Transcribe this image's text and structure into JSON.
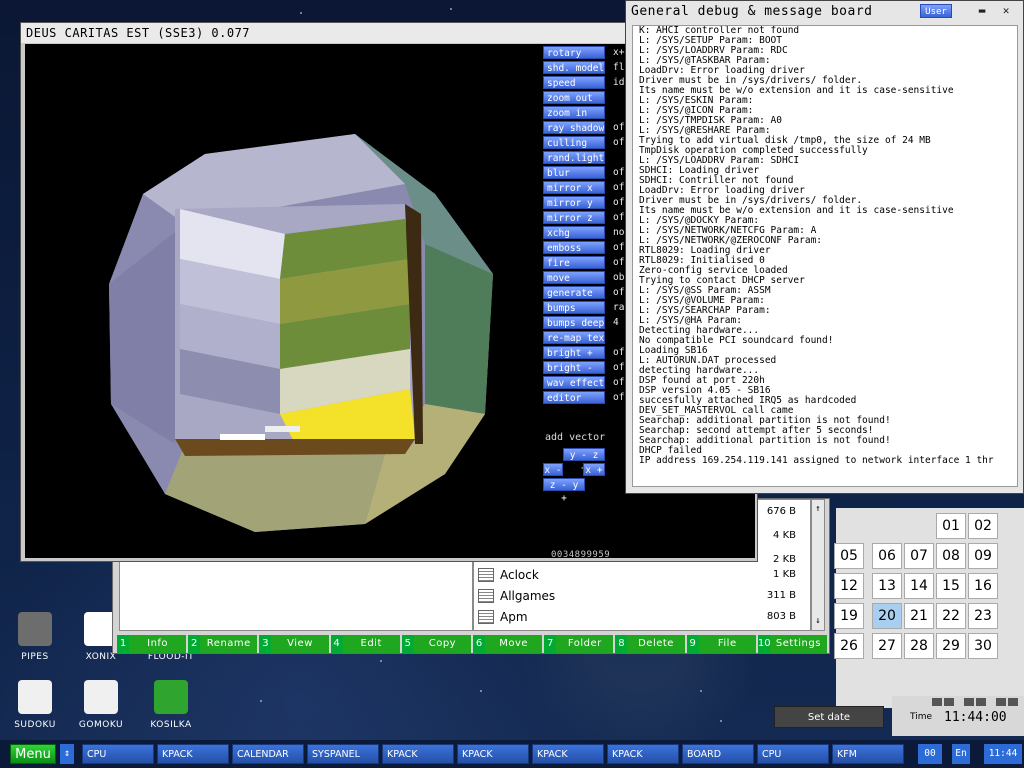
{
  "demo": {
    "title": "DEUS CARITAS EST (SSE3) 0.077",
    "menu": [
      {
        "label": "rotary",
        "value": "x+"
      },
      {
        "label": "shd. model",
        "value": "fl"
      },
      {
        "label": "speed",
        "value": "id"
      },
      {
        "label": "zoom out",
        "value": ""
      },
      {
        "label": "zoom in",
        "value": ""
      },
      {
        "label": "ray shadow",
        "value": "of"
      },
      {
        "label": "culling",
        "value": "of"
      },
      {
        "label": "rand.light",
        "value": ""
      },
      {
        "label": "blur",
        "value": "of"
      },
      {
        "label": "mirror x",
        "value": "of"
      },
      {
        "label": "mirror y",
        "value": "of"
      },
      {
        "label": "mirror z",
        "value": "of"
      },
      {
        "label": "xchg",
        "value": "no"
      },
      {
        "label": "emboss",
        "value": "of"
      },
      {
        "label": "fire",
        "value": "of"
      },
      {
        "label": "move",
        "value": "ob"
      },
      {
        "label": "generate",
        "value": "of"
      },
      {
        "label": "bumps",
        "value": "ra"
      },
      {
        "label": "bumps deep",
        "value": "4"
      },
      {
        "label": "re-map tex",
        "value": ""
      },
      {
        "label": "bright +",
        "value": "of"
      },
      {
        "label": "bright -",
        "value": "of"
      },
      {
        "label": "wav effect",
        "value": "of"
      },
      {
        "label": "editor",
        "value": "of"
      }
    ],
    "add_vector_label": "add vector",
    "vector_buttons": {
      "yz": "y - z +",
      "xm": "x -",
      "xp": "x +",
      "zy": "z - y +"
    },
    "counter": "0034899959"
  },
  "debug": {
    "title": "General debug & message board",
    "user_button": "User",
    "close_glyph": "✕",
    "min_glyph": "▬",
    "lines": [
      "K: AHCI controller not found",
      "L: /SYS/SETUP Param: BOOT",
      "L: /SYS/LOADDRV Param: RDC",
      "L: /SYS/@TASKBAR Param:",
      "LoadDrv: Error loading driver",
      "Driver must be in /sys/drivers/ folder.",
      "Its name must be w/o extension and it is case-sensitive",
      "L: /SYS/ESKIN Param:",
      "L: /SYS/@ICON Param:",
      "L: /SYS/TMPDISK Param: A0",
      "L: /SYS/@RESHARE Param:",
      "Trying to add virtual disk /tmp0, the size of 24 MB",
      "TmpDisk operation completed successfully",
      "L: /SYS/LOADDRV Param: SDHCI",
      "SDHCI: Loading driver",
      "SDHCI: Contriller not found",
      "LoadDrv: Error loading driver",
      "Driver must be in /sys/drivers/ folder.",
      "Its name must be w/o extension and it is case-sensitive",
      "L: /SYS/@DOCKY Param:",
      "L: /SYS/NETWORK/NETCFG Param: A",
      "L: /SYS/NETWORK/@ZEROCONF Param:",
      "RTL8029: Loading driver",
      "RTL8029: Initialised 0",
      "Zero-config service loaded",
      "Trying to contact DHCP server",
      "L: /SYS/@SS Param: ASSM",
      "L: /SYS/@VOLUME Param:",
      "L: /SYS/SEARCHAP Param:",
      "L: /SYS/@HA Param:",
      "Detecting hardware...",
      "No compatible PCI soundcard found!",
      "Loading SB16",
      "L: AUTORUN.DAT processed",
      "detecting hardware...",
      "DSP found at port 220h",
      "DSP version 4.05 - SB16",
      "succesfully attached IRQ5 as hardcoded",
      "DEV_SET_MASTERVOL call came",
      "Searchap: additional partition is not found!",
      "Searchap: second attempt after 5 seconds!",
      "Searchap: additional partition is not found!",
      "DHCP failed",
      "IP address 169.254.119.141 assigned to network interface 1 thr"
    ]
  },
  "filemanager": {
    "partial_sizes": [
      "676 B",
      "4 KB",
      "2 KB"
    ],
    "files": [
      {
        "name": "Aclock",
        "size": "1 KB"
      },
      {
        "name": "Allgames",
        "size": "311 B"
      },
      {
        "name": "Apm",
        "size": "803 B"
      }
    ],
    "keys": [
      {
        "num": "1",
        "label": "Info"
      },
      {
        "num": "2",
        "label": "Rename"
      },
      {
        "num": "3",
        "label": "View"
      },
      {
        "num": "4",
        "label": "Edit"
      },
      {
        "num": "5",
        "label": "Copy"
      },
      {
        "num": "6",
        "label": "Move"
      },
      {
        "num": "7",
        "label": "Folder"
      },
      {
        "num": "8",
        "label": "Delete"
      },
      {
        "num": "9",
        "label": "File"
      },
      {
        "num": "10",
        "label": "Settings"
      }
    ],
    "scroll_up": "↑",
    "scroll_down": "↓"
  },
  "desktop_icons": [
    {
      "label": "PIPES",
      "icon": "pipes-icon",
      "color": "#6d6d6d"
    },
    {
      "label": "XONIX",
      "icon": "xonix-icon",
      "color": "#ffffff"
    },
    {
      "label": "FLOOD-IT",
      "icon": "flood-it-icon",
      "color": "#d23a3a"
    },
    {
      "label": "SUDOKU",
      "icon": "sudoku-icon",
      "color": "#f0f0f0"
    },
    {
      "label": "GOMOKU",
      "icon": "gomoku-icon",
      "color": "#f0f0f0"
    },
    {
      "label": "KOSILKA",
      "icon": "lawnmower-icon",
      "color": "#2fa52f"
    }
  ],
  "calendar": {
    "rows": [
      [
        "",
        "",
        "",
        "01",
        "02"
      ],
      [
        "05",
        "06",
        "07",
        "08",
        "09"
      ],
      [
        "12",
        "13",
        "14",
        "15",
        "16"
      ],
      [
        "19",
        "20",
        "21",
        "22",
        "23"
      ],
      [
        "26",
        "27",
        "28",
        "29",
        "30"
      ]
    ],
    "today": "20",
    "set_date_label": "Set date",
    "time_label": "Time",
    "time_value": "11:44:00"
  },
  "taskbar": {
    "menu_label": "Menu",
    "swap_glyph": "↕",
    "tasks": [
      "CPU",
      "KPACK",
      "CALENDAR",
      "SYSPANEL",
      "KPACK",
      "KPACK",
      "KPACK",
      "KPACK",
      "BOARD",
      "CPU",
      "KFM"
    ],
    "page": "00",
    "lang": "En",
    "clock": "11:44"
  }
}
